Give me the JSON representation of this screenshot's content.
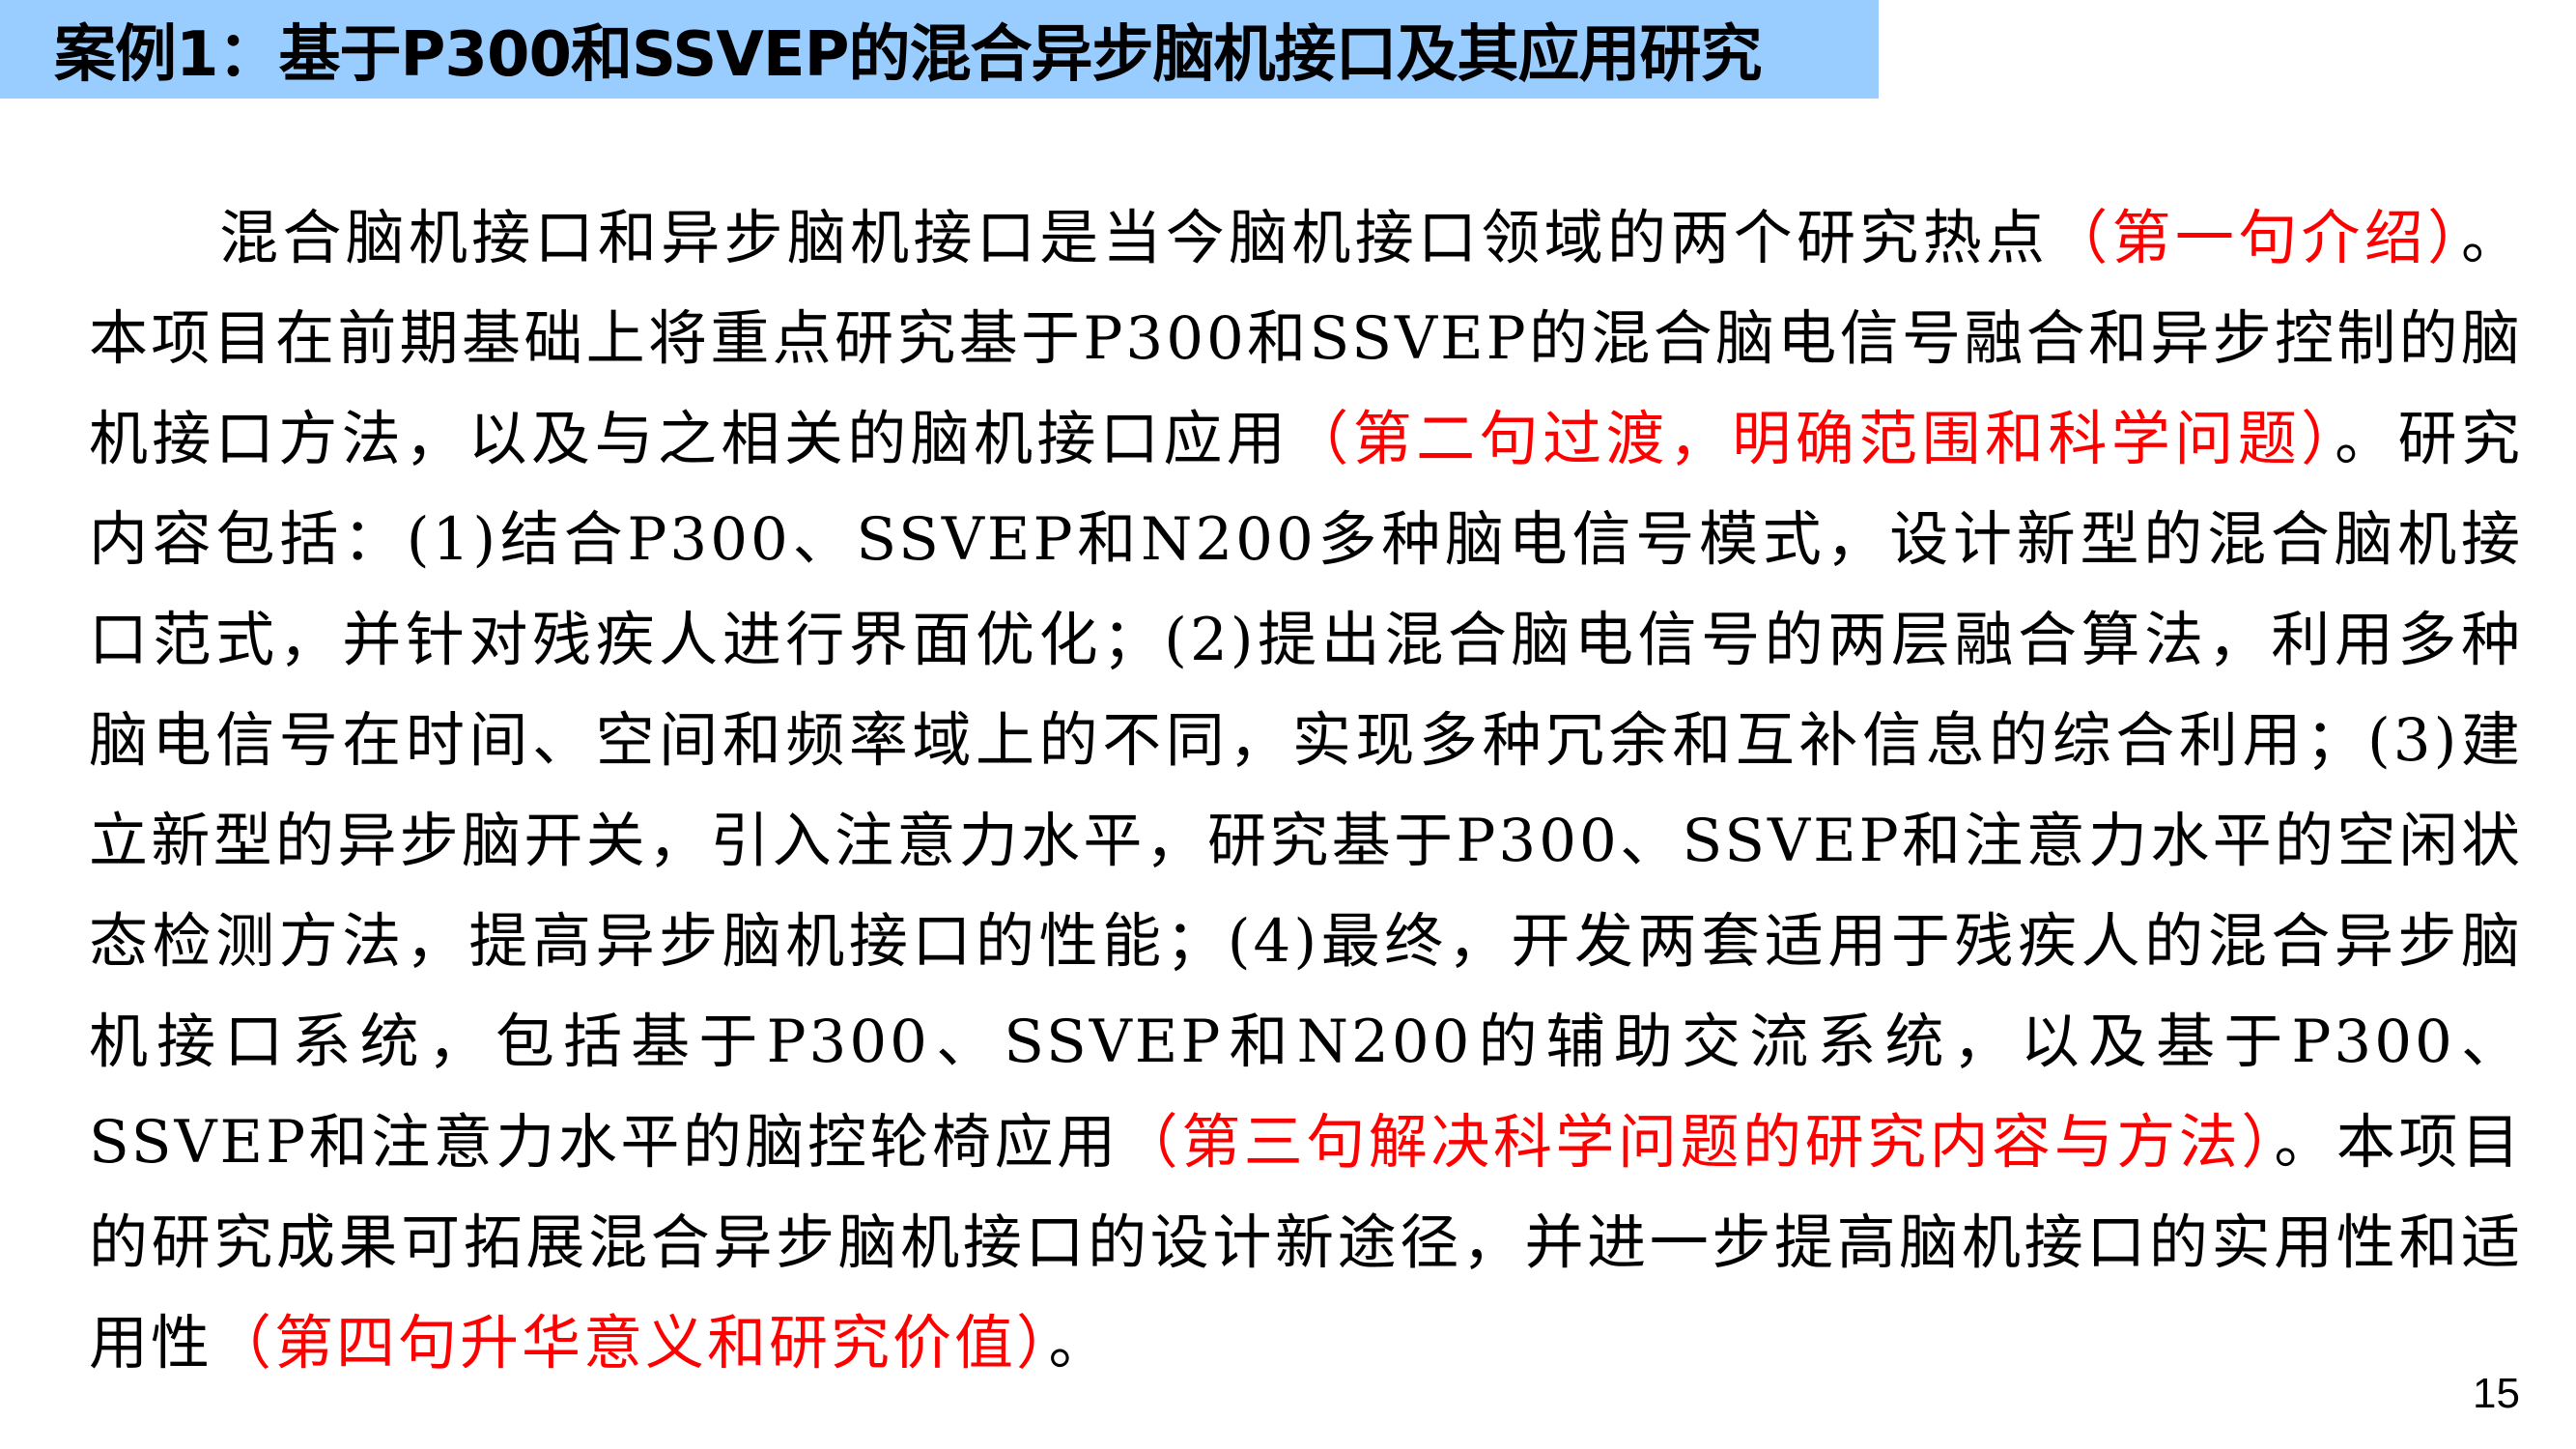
{
  "slide": {
    "title": "案例1：基于P300和SSVEP的混合异步脑机接口及其应用研究",
    "page_number": "15",
    "colors": {
      "title_bar": "#99ccff",
      "note": "#ff0000",
      "text": "#000000"
    }
  },
  "paragraph": {
    "seg1": "混合脑机接口和异步脑机接口是当今脑机接口领域的两个研究热点",
    "note1": "（第一句介绍）",
    "seg2": "。本项目在前期基础上将重点研究基于P300和SSVEP的混合脑电信号融合和异步控制的脑机接口方法，以及与之相关的脑机接口应用",
    "note2": "（第二句过渡，明确范围和科学问题）",
    "seg3": "。研究内容包括：(1)结合P300、SSVEP和N200多种脑电信号模式，设计新型的混合脑机接口范式，并针对残疾人进行界面优化；(2)提出混合脑电信号的两层融合算法，利用多种脑电信号在时间、空间和频率域上的不同，实现多种冗余和互补信息的综合利用；(3)建立新型的异步脑开关，引入注意力水平，研究基于P300、SSVEP和注意力水平的空闲状态检测方法，提高异步脑机接口的性能；(4)最终，开发两套适用于残疾人的混合异步脑机接口系统，包括基于P300、SSVEP和N200的辅助交流系统，以及基于P300、SSVEP和注意力水平的脑控轮椅应用",
    "note3": "（第三句解决科学问题的研究内容与方法）",
    "seg4": "。本项目的研究成果可拓展混合异步脑机接口的设计新途径，并进一步提高脑机接口的实用性和适用性",
    "note4": "（第四句升华意义和研究价值）",
    "seg5": "。"
  }
}
